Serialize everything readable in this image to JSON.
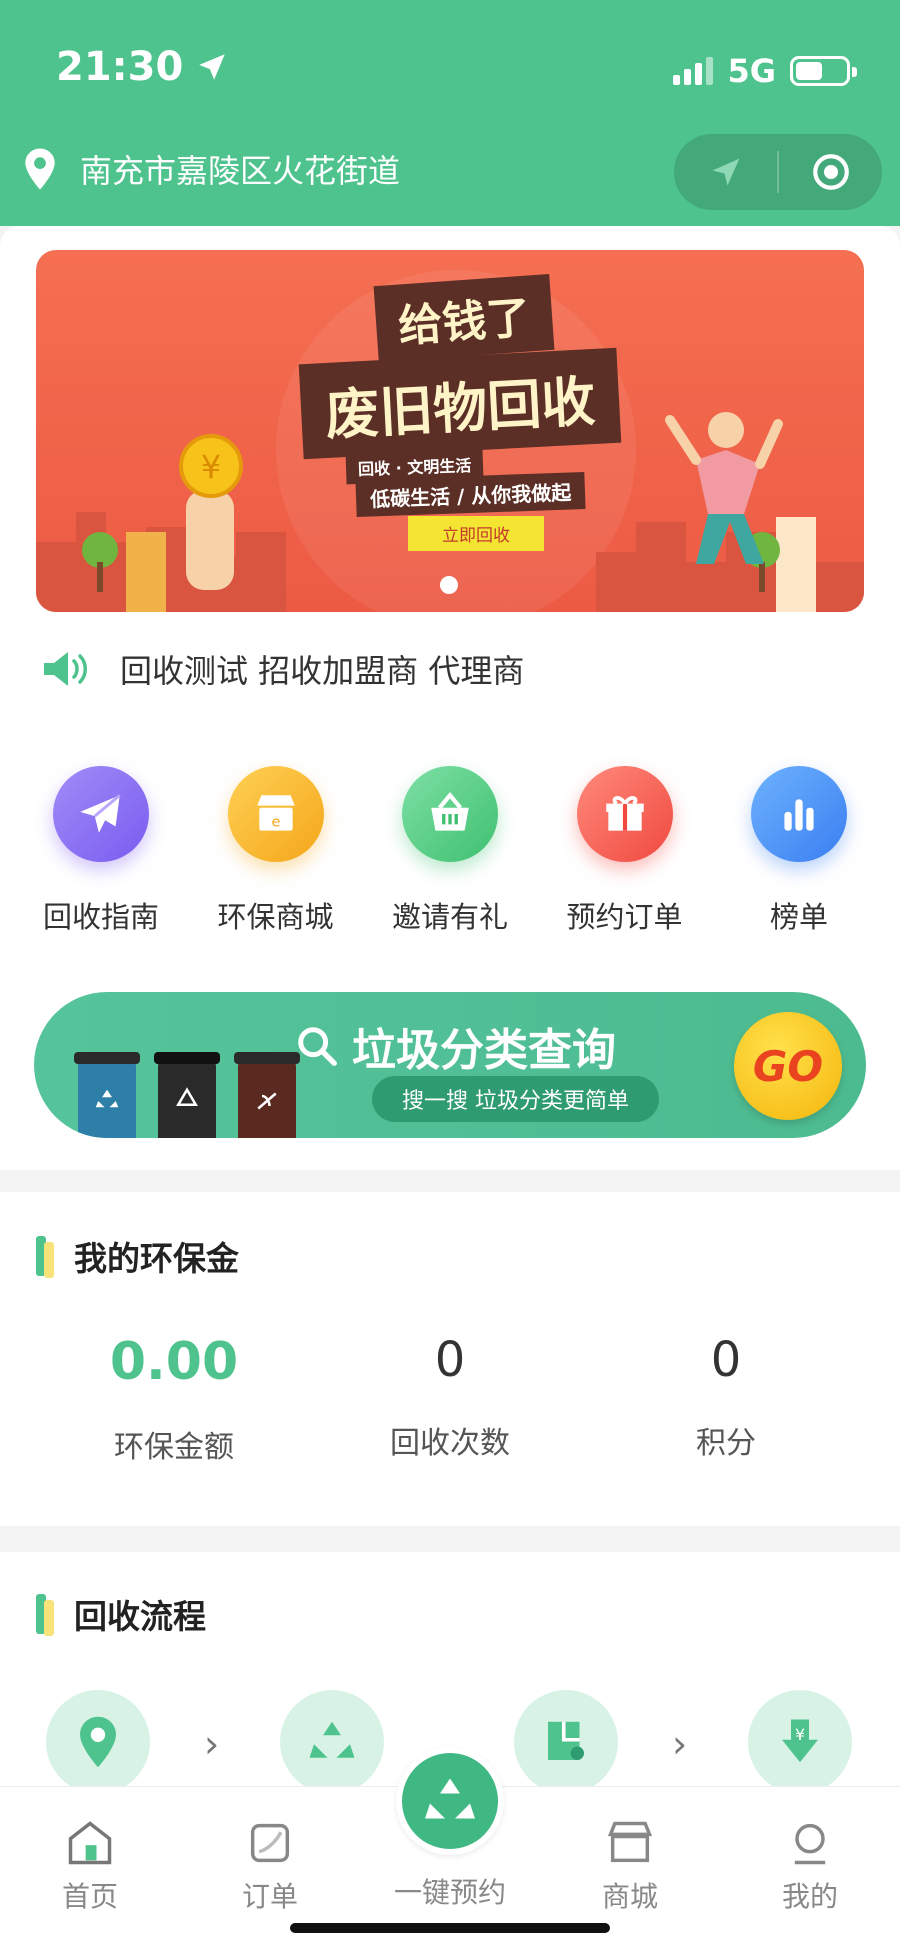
{
  "status_bar": {
    "time": "21:30",
    "network": "5G"
  },
  "header": {
    "location": "南充市嘉陵区火花街道"
  },
  "banner": {
    "line1": "给钱了",
    "line2": "废旧物回收",
    "line3": "回收 · 文明生活",
    "line4": "低碳生活 / 从你我做起",
    "button": "立即回收"
  },
  "notice": {
    "text": "回收测试 招收加盟商 代理商"
  },
  "menu": {
    "items": [
      {
        "label": "回收指南",
        "icon": "paper-plane-icon",
        "color": "#8d74f2"
      },
      {
        "label": "环保商城",
        "icon": "shop-icon",
        "color": "#f5b52c"
      },
      {
        "label": "邀请有礼",
        "icon": "basket-icon",
        "color": "#4fcf83"
      },
      {
        "label": "预约订单",
        "icon": "gift-icon",
        "color": "#f4645a"
      },
      {
        "label": "榜单",
        "icon": "bar-chart-icon",
        "color": "#4a90f0"
      }
    ]
  },
  "sort_banner": {
    "title": "垃圾分类查询",
    "subtitle": "搜一搜 垃圾分类更简单",
    "go": "GO"
  },
  "funds": {
    "title": "我的环保金",
    "stats": [
      {
        "value": "0.00",
        "label": "环保金额"
      },
      {
        "value": "0",
        "label": "回收次数"
      },
      {
        "value": "0",
        "label": "积分"
      }
    ]
  },
  "process": {
    "title": "回收流程"
  },
  "tabbar": {
    "tabs": [
      {
        "label": "首页"
      },
      {
        "label": "订单"
      },
      {
        "label": "一键预约"
      },
      {
        "label": "商城"
      },
      {
        "label": "我的"
      }
    ]
  },
  "colors": {
    "brand": "#4ec38d",
    "banner": "#ec5a43"
  }
}
